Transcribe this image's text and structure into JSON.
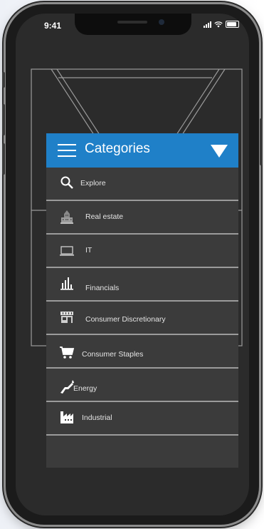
{
  "status_bar": {
    "time": "9:41"
  },
  "categories": {
    "title": "Categories",
    "items": [
      {
        "label": "Explore",
        "icon": "search-icon"
      },
      {
        "label": "Real estate",
        "icon": "building-icon"
      },
      {
        "label": "IT",
        "icon": "laptop-icon"
      },
      {
        "label": "Financials",
        "icon": "bar-chart-icon"
      },
      {
        "label": "Consumer Discretionary",
        "icon": "store-icon"
      },
      {
        "label": "Consumer Staples",
        "icon": "cart-icon"
      },
      {
        "label": "Energy",
        "icon": "fuel-nozzle-icon"
      },
      {
        "label": "Industrial",
        "icon": "factory-icon"
      }
    ]
  },
  "colors": {
    "header_blue": "#1f80c8",
    "panel_gray": "#3b3b3b",
    "screen_bg": "#2b2b2b"
  }
}
